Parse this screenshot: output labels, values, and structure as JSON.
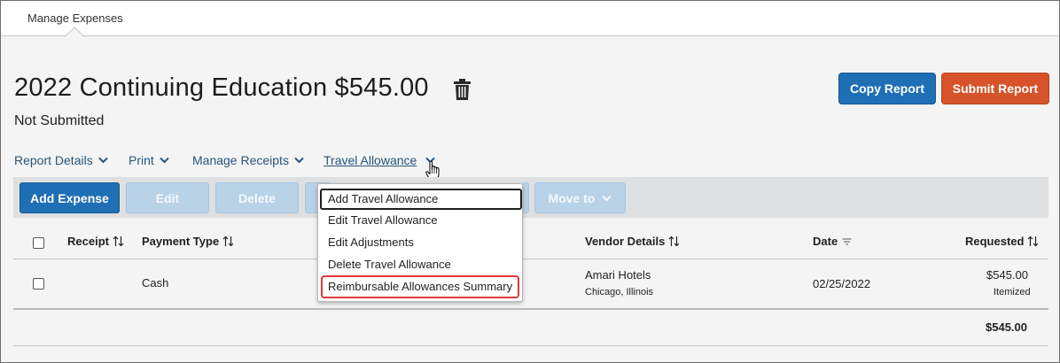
{
  "topbar": {
    "tab_label": "Manage Expenses"
  },
  "report": {
    "title": "2022 Continuing Education $545.00",
    "status": "Not Submitted"
  },
  "actions": {
    "copy_label": "Copy Report",
    "submit_label": "Submit Report"
  },
  "nav_menus": [
    {
      "label": "Report Details"
    },
    {
      "label": "Print"
    },
    {
      "label": "Manage Receipts"
    },
    {
      "label": "Travel Allowance"
    }
  ],
  "toolbar": {
    "add_label": "Add Expense",
    "edit_label": "Edit",
    "delete_label": "Delete",
    "move_label": "Move to"
  },
  "dropdown": {
    "items": [
      {
        "label": "Add Travel Allowance"
      },
      {
        "label": "Edit Travel Allowance"
      },
      {
        "label": "Edit Adjustments"
      },
      {
        "label": "Delete Travel Allowance"
      },
      {
        "label": "Reimbursable Allowances Summary"
      }
    ]
  },
  "table": {
    "headers": {
      "receipt": "Receipt",
      "payment_type": "Payment Type",
      "vendor": "Vendor Details",
      "date": "Date",
      "requested": "Requested"
    },
    "rows": [
      {
        "payment_type": "Cash",
        "vendor_name": "Amari Hotels",
        "vendor_location": "Chicago, Illinois",
        "date": "02/25/2022",
        "amount": "$545.00",
        "amount_note": "Itemized"
      }
    ],
    "total": "$545.00"
  },
  "colors": {
    "primary": "#1f6fb5",
    "submit": "#d6532a",
    "link": "#27557d",
    "highlight": "#e0393b"
  }
}
